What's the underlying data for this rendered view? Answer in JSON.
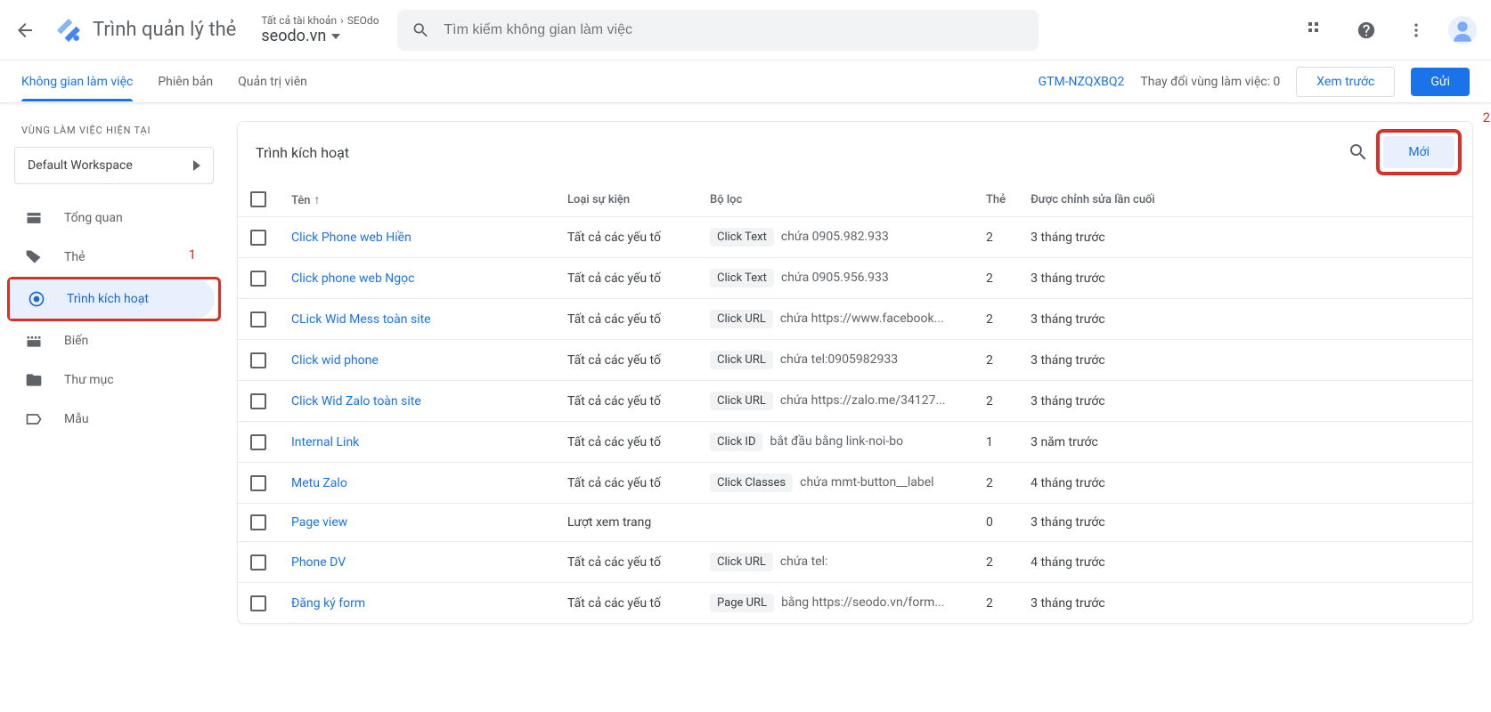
{
  "header": {
    "app_title": "Trình quản lý thẻ",
    "breadcrumb_accounts": "Tất cả tài khoản",
    "breadcrumb_sep": "›",
    "breadcrumb_current": "SEOdo",
    "container_name": "seodo.vn",
    "search_placeholder": "Tìm kiếm không gian làm việc"
  },
  "tabs": {
    "workspace": "Không gian làm việc",
    "versions": "Phiên bản",
    "admin": "Quản trị viên",
    "gtm_id": "GTM-NZQXBQ2",
    "changes_label": "Thay đổi vùng làm việc: 0",
    "preview": "Xem trước",
    "submit": "Gửi"
  },
  "sidebar": {
    "ws_label": "VÙNG LÀM VIỆC HIỆN TẠI",
    "ws_name": "Default Workspace",
    "items": [
      {
        "label": "Tổng quan"
      },
      {
        "label": "Thẻ"
      },
      {
        "label": "Trình kích hoạt"
      },
      {
        "label": "Biến"
      },
      {
        "label": "Thư mục"
      },
      {
        "label": "Mẫu"
      }
    ]
  },
  "annotations": {
    "one": "1",
    "two": "2"
  },
  "card": {
    "title": "Trình kích hoạt",
    "new_btn": "Mới",
    "columns": {
      "name": "Tên",
      "event": "Loại sự kiện",
      "filter": "Bộ lọc",
      "tag": "Thẻ",
      "modified": "Được chỉnh sửa lần cuối"
    }
  },
  "rows": [
    {
      "name": "Click Phone web Hiền",
      "event": "Tất cả các yếu tố",
      "chip": "Click Text",
      "filter_text": "chứa 0905.982.933",
      "tag": "2",
      "modified": "3 tháng trước"
    },
    {
      "name": "Click phone web Ngọc",
      "event": "Tất cả các yếu tố",
      "chip": "Click Text",
      "filter_text": "chứa 0905.956.933",
      "tag": "2",
      "modified": "3 tháng trước"
    },
    {
      "name": "CLick Wid Mess toàn site",
      "event": "Tất cả các yếu tố",
      "chip": "Click URL",
      "filter_text": "chứa https://www.facebook...",
      "tag": "2",
      "modified": "3 tháng trước"
    },
    {
      "name": "Click wid phone",
      "event": "Tất cả các yếu tố",
      "chip": "Click URL",
      "filter_text": "chứa tel:0905982933",
      "tag": "2",
      "modified": "3 tháng trước"
    },
    {
      "name": "Click Wid Zalo toàn site",
      "event": "Tất cả các yếu tố",
      "chip": "Click URL",
      "filter_text": "chứa https://zalo.me/34127...",
      "tag": "2",
      "modified": "3 tháng trước"
    },
    {
      "name": "Internal Link",
      "event": "Tất cả các yếu tố",
      "chip": "Click ID",
      "filter_text": "bắt đầu bằng link-noi-bo",
      "tag": "1",
      "modified": "3 năm trước"
    },
    {
      "name": "Metu Zalo",
      "event": "Tất cả các yếu tố",
      "chip": "Click Classes",
      "filter_text": "chứa mmt-button__label",
      "tag": "2",
      "modified": "4 tháng trước"
    },
    {
      "name": "Page view",
      "event": "Lượt xem trang",
      "chip": "",
      "filter_text": "",
      "tag": "0",
      "modified": "3 tháng trước"
    },
    {
      "name": "Phone DV",
      "event": "Tất cả các yếu tố",
      "chip": "Click URL",
      "filter_text": "chứa tel:",
      "tag": "2",
      "modified": "4 tháng trước"
    },
    {
      "name": "Đăng ký form",
      "event": "Tất cả các yếu tố",
      "chip": "Page URL",
      "filter_text": "bằng https://seodo.vn/form...",
      "tag": "2",
      "modified": "3 tháng trước"
    }
  ]
}
